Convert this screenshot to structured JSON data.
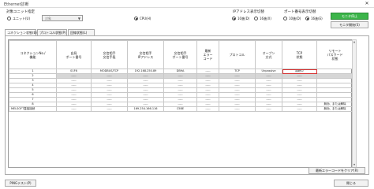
{
  "window": {
    "title": "Ethernet診断",
    "close_glyph": "✕"
  },
  "target_unit": {
    "label": "対象ユニット指定",
    "option1": "ユニット(U)",
    "select_value": "対象",
    "option2": "CPU(H)"
  },
  "address_display": {
    "label": "IPアドレス表示切替",
    "option1": "10進(D)",
    "option2": "16進(X)"
  },
  "port_display": {
    "label": "ポート番号表示切替",
    "option1": "10進(D)",
    "option2": "16進(E)"
  },
  "buttons": {
    "monitor_stop": "モニタ停止",
    "monitor_start": "モニタ開始(S)",
    "error_clear": "最新エラーコードをクリア(R)",
    "ping_test": "PINGテスト(P)",
    "close": "閉じる"
  },
  "tabs": [
    "コネクション状態(B)",
    "プロトコル状態(P)",
    "回線状態(L)"
  ],
  "table": {
    "headers": [
      "コネクションNo./\n機能",
      "自局\nポート番号",
      "交信相手\n交信手段",
      "交信相手\nIPアドレス",
      "交信相手\nポート番号",
      "最新\nエラー\nコード",
      "プロトコル",
      "オープン\n方式",
      "TCP\n状態",
      "リモート\nパスワード\n状態"
    ],
    "rows": [
      [
        "1",
        "01F6",
        "MODBUS/TCP",
        "192.168.250.89",
        "DB9A",
        "-----",
        "TCP",
        "Unpassive",
        "接続中",
        ""
      ],
      [
        "2",
        "-----",
        "-----",
        "-----",
        "-----",
        "-----",
        "-----",
        "-----",
        "-----",
        ""
      ],
      [
        "3",
        "-----",
        "-----",
        "-----",
        "-----",
        "-----",
        "-----",
        "-----",
        "-----",
        ""
      ],
      [
        "4",
        "-----",
        "-----",
        "-----",
        "-----",
        "-----",
        "-----",
        "-----",
        "-----",
        ""
      ],
      [
        "5",
        "-----",
        "-----",
        "-----",
        "-----",
        "-----",
        "-----",
        "-----",
        "-----",
        ""
      ],
      [
        "6",
        "-----",
        "-----",
        "-----",
        "-----",
        "-----",
        "-----",
        "-----",
        "-----",
        ""
      ],
      [
        "7",
        "-----",
        "-----",
        "-----",
        "-----",
        "-----",
        "-----",
        "-----",
        "-----",
        ""
      ],
      [
        "8",
        "-----",
        "-----",
        "-----",
        "-----",
        "-----",
        "-----",
        "-----",
        "-----",
        "無効、または解除"
      ],
      [
        "MELSOFT直接接続",
        "-----",
        "-----",
        "169.254.166.116",
        "C5BE",
        "-----",
        "-----",
        "-----",
        "-----",
        "無効、または解除"
      ]
    ]
  }
}
